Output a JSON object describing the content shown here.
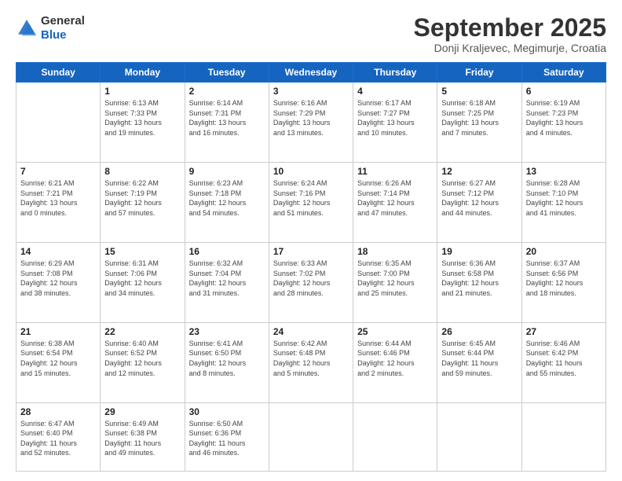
{
  "logo": {
    "general": "General",
    "blue": "Blue"
  },
  "header": {
    "month": "September 2025",
    "location": "Donji Kraljevec, Megimurje, Croatia"
  },
  "days_of_week": [
    "Sunday",
    "Monday",
    "Tuesday",
    "Wednesday",
    "Thursday",
    "Friday",
    "Saturday"
  ],
  "weeks": [
    [
      {
        "day": "",
        "info": ""
      },
      {
        "day": "1",
        "info": "Sunrise: 6:13 AM\nSunset: 7:33 PM\nDaylight: 13 hours\nand 19 minutes."
      },
      {
        "day": "2",
        "info": "Sunrise: 6:14 AM\nSunset: 7:31 PM\nDaylight: 13 hours\nand 16 minutes."
      },
      {
        "day": "3",
        "info": "Sunrise: 6:16 AM\nSunset: 7:29 PM\nDaylight: 13 hours\nand 13 minutes."
      },
      {
        "day": "4",
        "info": "Sunrise: 6:17 AM\nSunset: 7:27 PM\nDaylight: 13 hours\nand 10 minutes."
      },
      {
        "day": "5",
        "info": "Sunrise: 6:18 AM\nSunset: 7:25 PM\nDaylight: 13 hours\nand 7 minutes."
      },
      {
        "day": "6",
        "info": "Sunrise: 6:19 AM\nSunset: 7:23 PM\nDaylight: 13 hours\nand 4 minutes."
      }
    ],
    [
      {
        "day": "7",
        "info": "Sunrise: 6:21 AM\nSunset: 7:21 PM\nDaylight: 13 hours\nand 0 minutes."
      },
      {
        "day": "8",
        "info": "Sunrise: 6:22 AM\nSunset: 7:19 PM\nDaylight: 12 hours\nand 57 minutes."
      },
      {
        "day": "9",
        "info": "Sunrise: 6:23 AM\nSunset: 7:18 PM\nDaylight: 12 hours\nand 54 minutes."
      },
      {
        "day": "10",
        "info": "Sunrise: 6:24 AM\nSunset: 7:16 PM\nDaylight: 12 hours\nand 51 minutes."
      },
      {
        "day": "11",
        "info": "Sunrise: 6:26 AM\nSunset: 7:14 PM\nDaylight: 12 hours\nand 47 minutes."
      },
      {
        "day": "12",
        "info": "Sunrise: 6:27 AM\nSunset: 7:12 PM\nDaylight: 12 hours\nand 44 minutes."
      },
      {
        "day": "13",
        "info": "Sunrise: 6:28 AM\nSunset: 7:10 PM\nDaylight: 12 hours\nand 41 minutes."
      }
    ],
    [
      {
        "day": "14",
        "info": "Sunrise: 6:29 AM\nSunset: 7:08 PM\nDaylight: 12 hours\nand 38 minutes."
      },
      {
        "day": "15",
        "info": "Sunrise: 6:31 AM\nSunset: 7:06 PM\nDaylight: 12 hours\nand 34 minutes."
      },
      {
        "day": "16",
        "info": "Sunrise: 6:32 AM\nSunset: 7:04 PM\nDaylight: 12 hours\nand 31 minutes."
      },
      {
        "day": "17",
        "info": "Sunrise: 6:33 AM\nSunset: 7:02 PM\nDaylight: 12 hours\nand 28 minutes."
      },
      {
        "day": "18",
        "info": "Sunrise: 6:35 AM\nSunset: 7:00 PM\nDaylight: 12 hours\nand 25 minutes."
      },
      {
        "day": "19",
        "info": "Sunrise: 6:36 AM\nSunset: 6:58 PM\nDaylight: 12 hours\nand 21 minutes."
      },
      {
        "day": "20",
        "info": "Sunrise: 6:37 AM\nSunset: 6:56 PM\nDaylight: 12 hours\nand 18 minutes."
      }
    ],
    [
      {
        "day": "21",
        "info": "Sunrise: 6:38 AM\nSunset: 6:54 PM\nDaylight: 12 hours\nand 15 minutes."
      },
      {
        "day": "22",
        "info": "Sunrise: 6:40 AM\nSunset: 6:52 PM\nDaylight: 12 hours\nand 12 minutes."
      },
      {
        "day": "23",
        "info": "Sunrise: 6:41 AM\nSunset: 6:50 PM\nDaylight: 12 hours\nand 8 minutes."
      },
      {
        "day": "24",
        "info": "Sunrise: 6:42 AM\nSunset: 6:48 PM\nDaylight: 12 hours\nand 5 minutes."
      },
      {
        "day": "25",
        "info": "Sunrise: 6:44 AM\nSunset: 6:46 PM\nDaylight: 12 hours\nand 2 minutes."
      },
      {
        "day": "26",
        "info": "Sunrise: 6:45 AM\nSunset: 6:44 PM\nDaylight: 11 hours\nand 59 minutes."
      },
      {
        "day": "27",
        "info": "Sunrise: 6:46 AM\nSunset: 6:42 PM\nDaylight: 11 hours\nand 55 minutes."
      }
    ],
    [
      {
        "day": "28",
        "info": "Sunrise: 6:47 AM\nSunset: 6:40 PM\nDaylight: 11 hours\nand 52 minutes."
      },
      {
        "day": "29",
        "info": "Sunrise: 6:49 AM\nSunset: 6:38 PM\nDaylight: 11 hours\nand 49 minutes."
      },
      {
        "day": "30",
        "info": "Sunrise: 6:50 AM\nSunset: 6:36 PM\nDaylight: 11 hours\nand 46 minutes."
      },
      {
        "day": "",
        "info": ""
      },
      {
        "day": "",
        "info": ""
      },
      {
        "day": "",
        "info": ""
      },
      {
        "day": "",
        "info": ""
      }
    ]
  ]
}
